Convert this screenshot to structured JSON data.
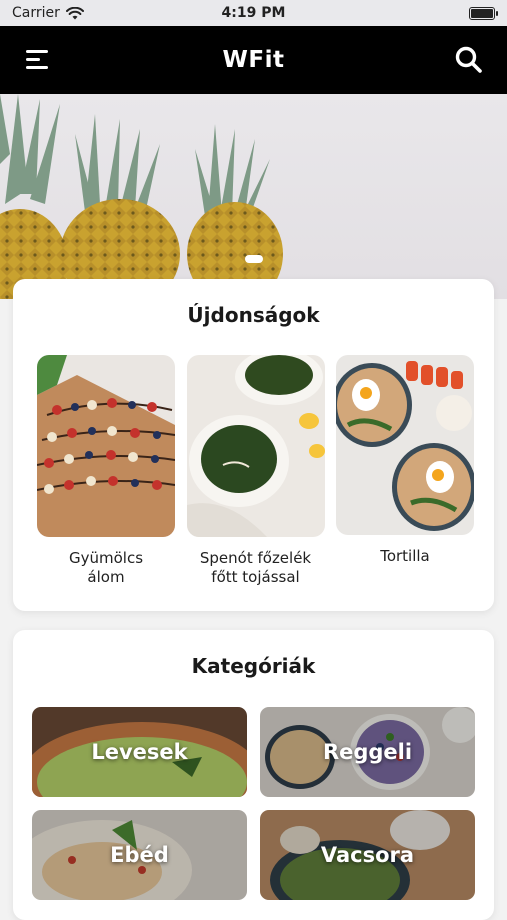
{
  "status": {
    "carrier": "Carrier",
    "time": "4:19 PM"
  },
  "nav": {
    "title": "WFit"
  },
  "hero": {
    "active_slide": 1,
    "slide_count": 1
  },
  "new_section": {
    "title": "Újdonságok",
    "items": [
      {
        "label": "Gyümölcs\nálom"
      },
      {
        "label": "Spenót főzelék\nfőtt tojással"
      },
      {
        "label": "Tortilla"
      }
    ]
  },
  "categories_section": {
    "title": "Kategóriák",
    "items": [
      {
        "label": "Levesek"
      },
      {
        "label": "Reggeli"
      },
      {
        "label": "Ebéd"
      },
      {
        "label": "Vacsora"
      }
    ]
  },
  "colors": {
    "nav_bg": "#000000",
    "card_bg": "#ffffff",
    "page_bg": "#f2f2f2"
  }
}
